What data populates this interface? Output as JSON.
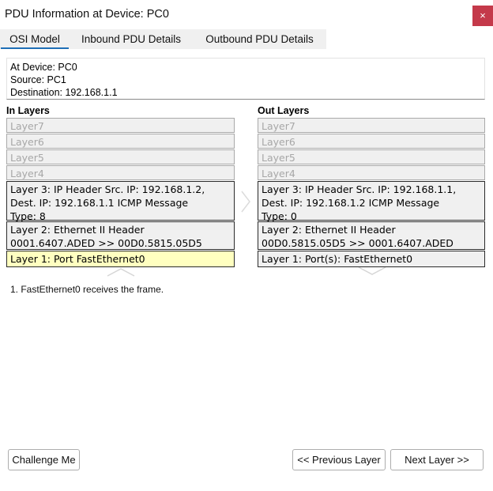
{
  "window": {
    "title": "PDU Information at Device: PC0",
    "close_label": "×"
  },
  "tabs": [
    {
      "label": "OSI Model",
      "active": true
    },
    {
      "label": "Inbound PDU Details",
      "active": false
    },
    {
      "label": "Outbound PDU Details",
      "active": false
    }
  ],
  "info": {
    "device": "At Device: PC0",
    "source": "Source: PC1",
    "destination": "Destination: 192.168.1.1"
  },
  "in_layers": {
    "header": "In Layers",
    "layer7": "Layer7",
    "layer6": "Layer6",
    "layer5": "Layer5",
    "layer4": "Layer4",
    "layer3": [
      "Layer 3: IP Header Src. IP: 192.168.1.2,",
      "Dest. IP: 192.168.1.1 ICMP Message",
      "Type: 8"
    ],
    "layer2": [
      "Layer 2: Ethernet II Header",
      "0001.6407.ADED >> 00D0.5815.05D5"
    ],
    "layer1": "Layer 1: Port FastEthernet0"
  },
  "out_layers": {
    "header": "Out Layers",
    "layer7": "Layer7",
    "layer6": "Layer6",
    "layer5": "Layer5",
    "layer4": "Layer4",
    "layer3": [
      "Layer 3: IP Header Src. IP: 192.168.1.1,",
      "Dest. IP: 192.168.1.2 ICMP Message",
      "Type: 0"
    ],
    "layer2": [
      "Layer 2: Ethernet II Header",
      "00D0.5815.05D5 >> 0001.6407.ADED"
    ],
    "layer1": "Layer 1: Port(s): FastEthernet0"
  },
  "description": "1. FastEthernet0 receives the frame.",
  "buttons": {
    "challenge": "Challenge Me",
    "previous": "<< Previous Layer",
    "next": "Next Layer >>"
  },
  "colors": {
    "close_button": "#c4394a",
    "active_tab_underline": "#1f6fb7",
    "highlight_layer": "#ffffc0"
  },
  "icons": [
    "close-icon",
    "arrow-right-icon",
    "arrow-up-icon",
    "arrow-down-icon"
  ]
}
